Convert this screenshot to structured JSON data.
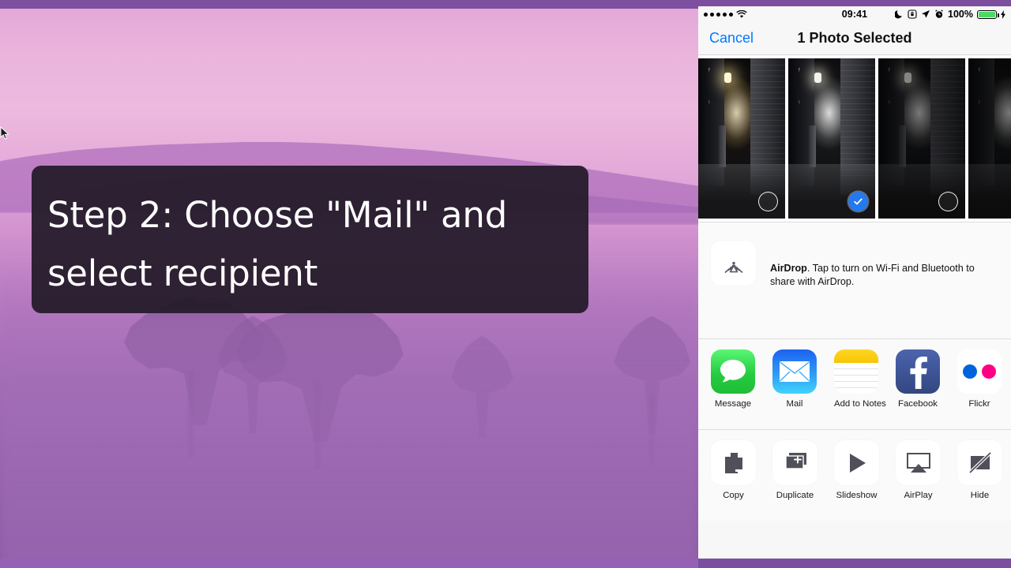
{
  "desktop": {
    "caption": {
      "line1": "Step 2: Choose \"Mail\" and",
      "line2": "select recipient"
    },
    "cursor_icon": "mouse-pointer-icon",
    "background_description": "foggy purple forest landscape"
  },
  "phone": {
    "status_bar": {
      "signal_icon": "signal-dots-icon",
      "wifi_icon": "wifi-icon",
      "time": "09:41",
      "do_not_disturb_icon": "moon-icon",
      "rotation_lock_icon": "rotation-lock-icon",
      "location_icon": "location-arrow-icon",
      "alarm_icon": "alarm-clock-icon",
      "battery_percent": "100%",
      "battery_icon": "battery-charging-icon",
      "battery_color": "#4cd964"
    },
    "nav": {
      "cancel_label": "Cancel",
      "cancel_color": "#007aff",
      "title": "1 Photo Selected"
    },
    "photos": [
      {
        "name": "alley-photo-1",
        "selected": false,
        "variant": "warm",
        "badge_icon": "empty-circle-icon"
      },
      {
        "name": "alley-photo-2",
        "selected": true,
        "variant": "normal",
        "badge_icon": "checkmark-circle-icon"
      },
      {
        "name": "alley-photo-3",
        "selected": false,
        "variant": "dark",
        "badge_icon": "empty-circle-icon"
      }
    ],
    "selected_color": "#2479ee",
    "airdrop": {
      "icon": "airdrop-icon",
      "title": "AirDrop",
      "description": ". Tap to turn on Wi-Fi and Bluetooth to share with AirDrop."
    },
    "apps": [
      {
        "label": "Message",
        "icon": "message-bubble-icon"
      },
      {
        "label": "Mail",
        "icon": "mail-envelope-icon"
      },
      {
        "label": "Add to Notes",
        "icon": "notes-icon"
      },
      {
        "label": "Facebook",
        "icon": "facebook-icon"
      },
      {
        "label": "Flickr",
        "icon": "flickr-icon"
      },
      {
        "label": "",
        "icon": "instagram-icon"
      }
    ],
    "actions": [
      {
        "label": "Copy",
        "icon": "copy-icon"
      },
      {
        "label": "Duplicate",
        "icon": "duplicate-icon"
      },
      {
        "label": "Slideshow",
        "icon": "play-triangle-icon"
      },
      {
        "label": "AirPlay",
        "icon": "airplay-icon"
      },
      {
        "label": "Hide",
        "icon": "hide-slash-icon"
      },
      {
        "label": "",
        "icon": "more-action-icon"
      }
    ]
  }
}
